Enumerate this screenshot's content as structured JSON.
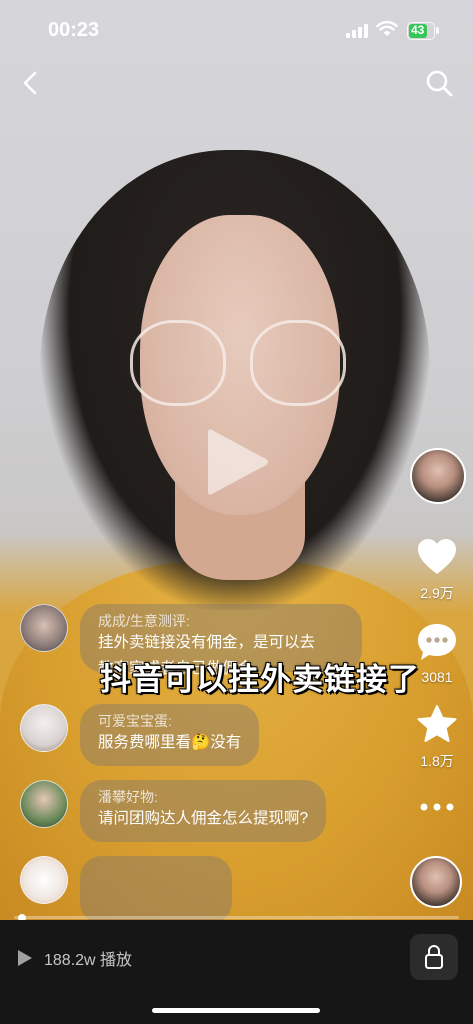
{
  "status_bar": {
    "time": "00:23",
    "battery": "43"
  },
  "video": {
    "overlay_title": "抖音可以挂外卖链接了",
    "progress_fraction": 0.01
  },
  "side_actions": {
    "like_count": "2.9万",
    "comment_count": "3081",
    "favorite_count": "1.8万"
  },
  "comments": [
    {
      "name": "成成/生意测评:",
      "lines": [
        "挂外卖链接没有佣金，是可以去",
        "教商家或者自己做佣金"
      ]
    },
    {
      "name": "可爱宝宝蛋:",
      "lines": [
        "服务费哪里看🤔没有"
      ]
    },
    {
      "name": "潘攀好物:",
      "lines": [
        "请问团购达人佣金怎么提现啊?"
      ]
    }
  ],
  "bottom_bar": {
    "plays": "188.2w 播放"
  },
  "colors": {
    "shirt": "#d89e2e",
    "battery_green": "#35c759",
    "bottom_bg": "#161616"
  }
}
